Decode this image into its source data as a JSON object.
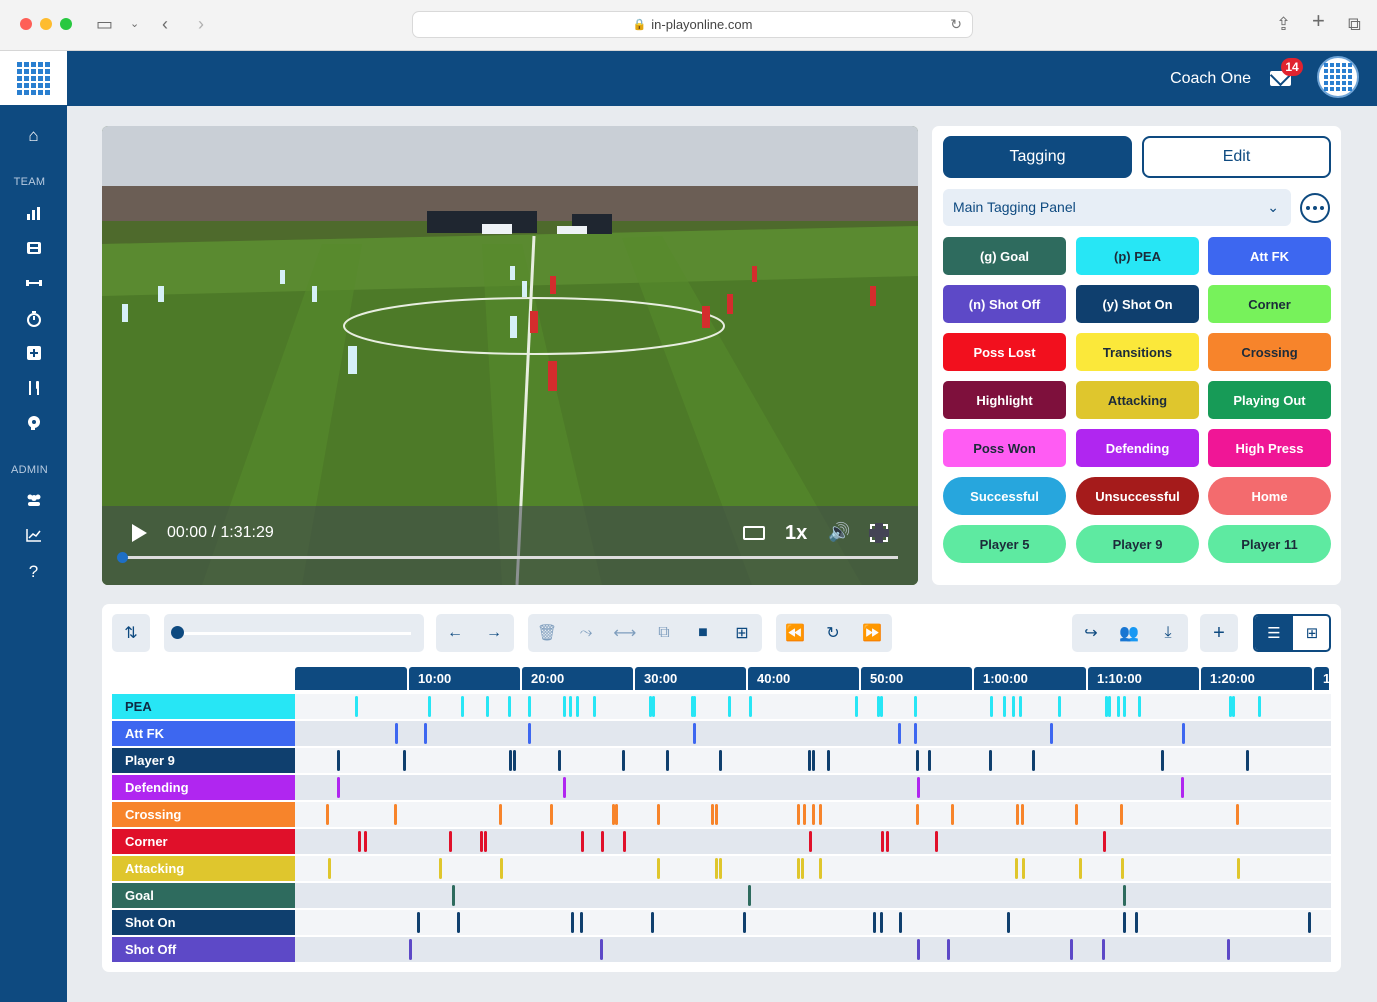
{
  "browser": {
    "url": "in-playonline.com"
  },
  "header": {
    "user_name": "Coach One",
    "notification_count": "14"
  },
  "sidebar": {
    "section_team": "TEAM",
    "section_admin": "ADMIN",
    "items": [
      "home-icon",
      "bar-chart-icon",
      "film-icon",
      "dumbbell-icon",
      "stopwatch-icon",
      "medical-icon",
      "cutlery-icon",
      "brain-icon",
      "users-icon",
      "line-chart-icon",
      "help-icon"
    ],
    "help_glyph": "?"
  },
  "video": {
    "time": "00:00 / 1:31:29",
    "speed": "1x",
    "progress": 0.0
  },
  "panel": {
    "tab_tagging": "Tagging",
    "tab_edit": "Edit",
    "select_value": "Main Tagging Panel",
    "buttons": [
      {
        "label": "(g) Goal",
        "color": "#2e6b5e"
      },
      {
        "label": "(p) PEA",
        "color": "#27e6f5",
        "dark": true
      },
      {
        "label": "Att FK",
        "color": "#3d67f0"
      },
      {
        "label": "(n) Shot Off",
        "color": "#5d49c7"
      },
      {
        "label": "(y) Shot On",
        "color": "#0f3f6e"
      },
      {
        "label": "Corner",
        "color": "#77f25b",
        "dark": true
      },
      {
        "label": "Poss Lost",
        "color": "#f2101e"
      },
      {
        "label": "Transitions",
        "color": "#fbe83a",
        "dark": true
      },
      {
        "label": "Crossing",
        "color": "#f7842b",
        "dark": true
      },
      {
        "label": "Highlight",
        "color": "#7e103c"
      },
      {
        "label": "Attacking",
        "color": "#dfc62d",
        "dark": true
      },
      {
        "label": "Playing Out",
        "color": "#179b57"
      },
      {
        "label": "Poss Won",
        "color": "#ff5cf3",
        "dark": true
      },
      {
        "label": "Defending",
        "color": "#b026f0"
      },
      {
        "label": "High Press",
        "color": "#f01696"
      },
      {
        "label": "Successful",
        "color": "#27a6dd",
        "pill": true
      },
      {
        "label": "Unsuccessful",
        "color": "#a51b1b",
        "pill": true
      },
      {
        "label": "Home",
        "color": "#f36b6e",
        "pill": true
      },
      {
        "label": "Player 5",
        "color": "#5eeaa1",
        "pill": true,
        "dark": true
      },
      {
        "label": "Player 9",
        "color": "#5eeaa1",
        "pill": true,
        "dark": true
      },
      {
        "label": "Player 11",
        "color": "#5eeaa1",
        "pill": true,
        "dark": true
      }
    ]
  },
  "timeline": {
    "ruler": [
      "",
      "10:00",
      "20:00",
      "30:00",
      "40:00",
      "50:00",
      "1:00:00",
      "1:10:00",
      "1:20:00",
      "1"
    ],
    "rows": [
      {
        "label": "PEA",
        "color": "#27e6f5",
        "dark": true,
        "marks": [
          60,
          133,
          166,
          191,
          213,
          233,
          268,
          274,
          281,
          298,
          354,
          357,
          396,
          398,
          433,
          454,
          560,
          582,
          585,
          619,
          695,
          708,
          717,
          724,
          763,
          810,
          813,
          822,
          828,
          843,
          934,
          937,
          963
        ]
      },
      {
        "label": "Att FK",
        "color": "#3d67f0",
        "marks": [
          100,
          129,
          233,
          398,
          603,
          619,
          755,
          887
        ]
      },
      {
        "label": "Player 9",
        "color": "#0f3f6e",
        "marks": [
          42,
          108,
          214,
          218,
          263,
          327,
          371,
          424,
          513,
          517,
          532,
          621,
          633,
          694,
          737,
          866,
          951
        ]
      },
      {
        "label": "Defending",
        "color": "#b026f0",
        "marks": [
          42,
          268,
          622,
          886
        ]
      },
      {
        "label": "Crossing",
        "color": "#f7842b",
        "marks": [
          31,
          99,
          204,
          255,
          317,
          320,
          362,
          416,
          420,
          502,
          508,
          517,
          524,
          621,
          656,
          721,
          726,
          780,
          825,
          941
        ]
      },
      {
        "label": "Corner",
        "color": "#e0102a",
        "marks": [
          63,
          69,
          154,
          185,
          189,
          286,
          306,
          328,
          514,
          586,
          591,
          640,
          808
        ]
      },
      {
        "label": "Attacking",
        "color": "#dfc62d",
        "marks": [
          33,
          144,
          205,
          362,
          420,
          424,
          502,
          506,
          524,
          720,
          727,
          784,
          826,
          942
        ]
      },
      {
        "label": "Goal",
        "color": "#2e6b5e",
        "marks": [
          157,
          453,
          828
        ]
      },
      {
        "label": "Shot On",
        "color": "#0f3f6e",
        "marks": [
          122,
          162,
          276,
          285,
          356,
          448,
          578,
          585,
          604,
          712,
          828,
          840,
          1013
        ]
      },
      {
        "label": "Shot Off",
        "color": "#5d49c7",
        "marks": [
          114,
          305,
          622,
          652,
          775,
          807,
          932
        ]
      }
    ]
  }
}
